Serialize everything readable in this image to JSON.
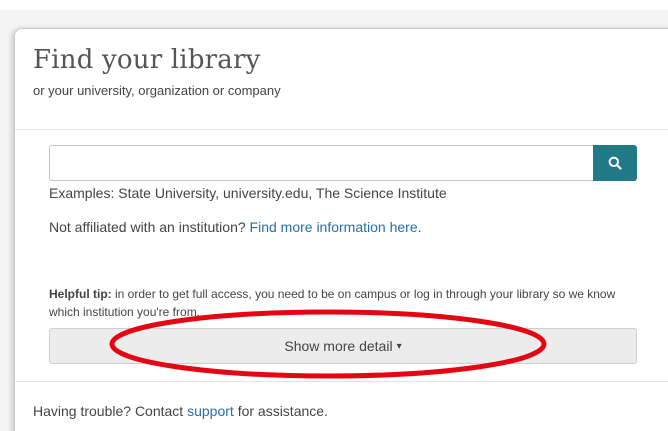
{
  "dialog": {
    "title": "Find your library",
    "subtitle": "or your university, organization or company"
  },
  "search": {
    "value": "",
    "placeholder": "",
    "button_icon": "search-icon"
  },
  "examples_text": "Examples: State University, university.edu, The Science Institute",
  "affiliation": {
    "prefix": "Not affiliated with an institution?",
    "link_text": "Find more information here",
    "suffix": "."
  },
  "tip": {
    "label": "Helpful tip:",
    "text": "in order to get full access, you need to be on campus or log in through your library so we know which institution you're from."
  },
  "detail_button": {
    "label": "Show more detail",
    "caret": "▾"
  },
  "footer": {
    "prefix": "Having trouble? Contact",
    "link_text": "support",
    "suffix": "for assistance."
  },
  "colors": {
    "accent": "#217a86",
    "link": "#2a6ea6",
    "annotation": "#e30613"
  }
}
